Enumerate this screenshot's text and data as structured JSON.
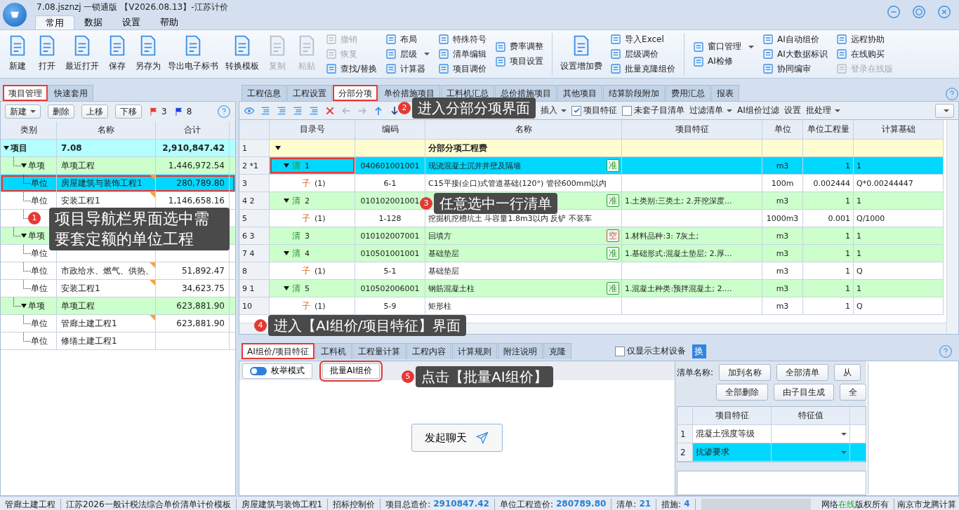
{
  "window": {
    "title": "7.08.jsznzj 一锁通版 【V2026.08.13】-江苏计价"
  },
  "menu_tabs": [
    {
      "label": "常用",
      "selected": true
    },
    {
      "label": "数据",
      "selected": false
    },
    {
      "label": "设置",
      "selected": false
    },
    {
      "label": "帮助",
      "selected": false
    }
  ],
  "ribbon": [
    {
      "kind": "large",
      "label": "新建",
      "disabled": false
    },
    {
      "kind": "large",
      "label": "打开",
      "disabled": false
    },
    {
      "kind": "large",
      "label": "最近打开",
      "disabled": false
    },
    {
      "kind": "large",
      "label": "保存",
      "disabled": false
    },
    {
      "kind": "large",
      "label": "另存为",
      "disabled": false
    },
    {
      "kind": "large",
      "label": "导出电子标书",
      "disabled": false
    },
    {
      "kind": "large",
      "label": "转换模板",
      "disabled": false
    },
    {
      "kind": "large",
      "label": "复制",
      "disabled": true
    },
    {
      "kind": "large",
      "label": "粘贴",
      "disabled": true
    },
    {
      "kind": "column",
      "items": [
        {
          "label": "撤销",
          "disabled": true,
          "dropdown": false
        },
        {
          "label": "恢复",
          "disabled": true,
          "dropdown": false
        },
        {
          "label": "查找/替换",
          "disabled": false,
          "dropdown": false
        }
      ]
    },
    {
      "kind": "column",
      "items": [
        {
          "label": "布局",
          "disabled": false,
          "dropdown": false
        },
        {
          "label": "层级",
          "disabled": false,
          "dropdown": true
        },
        {
          "label": "计算器",
          "disabled": false,
          "dropdown": false
        }
      ]
    },
    {
      "kind": "column",
      "items": [
        {
          "label": "特殊符号",
          "disabled": false,
          "dropdown": false
        },
        {
          "label": "清单编辑",
          "disabled": false,
          "dropdown": false
        },
        {
          "label": "项目调价",
          "disabled": false,
          "dropdown": false
        }
      ]
    },
    {
      "kind": "column",
      "items": [
        {
          "label": "费率调整",
          "disabled": false,
          "dropdown": false
        },
        {
          "label": "项目设置",
          "disabled": false,
          "dropdown": false
        }
      ]
    },
    {
      "kind": "separator"
    },
    {
      "kind": "large",
      "label": "设置增加费",
      "disabled": false
    },
    {
      "kind": "column",
      "items": [
        {
          "label": "导入Excel",
          "disabled": false,
          "dropdown": false
        },
        {
          "label": "层级调价",
          "disabled": false,
          "dropdown": false
        },
        {
          "label": "批量克隆组价",
          "disabled": false,
          "dropdown": false
        }
      ]
    },
    {
      "kind": "separator"
    },
    {
      "kind": "column",
      "items": [
        {
          "label": "窗口管理",
          "disabled": false,
          "dropdown": true
        },
        {
          "label": "AI检修",
          "disabled": false,
          "dropdown": false
        }
      ]
    },
    {
      "kind": "column",
      "items": [
        {
          "label": "AI自动组价",
          "disabled": false,
          "dropdown": false
        },
        {
          "label": "AI大数据标识",
          "disabled": false,
          "dropdown": false
        },
        {
          "label": "协同编审",
          "disabled": false,
          "dropdown": false
        }
      ]
    },
    {
      "kind": "column",
      "items": [
        {
          "label": "远程协助",
          "disabled": false,
          "dropdown": false
        },
        {
          "label": "在线购买",
          "disabled": false,
          "dropdown": false
        },
        {
          "label": "登录在线版",
          "disabled": true,
          "dropdown": false
        }
      ]
    }
  ],
  "left_panel": {
    "tabs": [
      {
        "label": "项目管理",
        "selected": true,
        "highlighted": true
      },
      {
        "label": "快速套用",
        "selected": false,
        "highlighted": false
      }
    ],
    "toolbar": {
      "buttons": [
        {
          "label": "新建",
          "dropdown": true
        },
        {
          "label": "删除",
          "dropdown": false
        },
        {
          "label": "上移",
          "dropdown": false
        },
        {
          "label": "下移",
          "dropdown": false
        }
      ],
      "red_flags": "3",
      "blue_flags": "8"
    },
    "tree": {
      "columns": [
        "类别",
        "名称",
        "合计"
      ],
      "items": [
        {
          "category": "项目",
          "name": "7.08",
          "total": "2,910,847.42",
          "selected": false,
          "highlighted": false,
          "marked": false,
          "expanded": true,
          "children": [
            {
              "category": "单项",
              "name": "单项工程",
              "total": "1,446,972.54",
              "selected": false,
              "highlighted": false,
              "marked": false,
              "expanded": true,
              "children": [
                {
                  "category": "单位",
                  "name": "房屋建筑与装饰工程1",
                  "total": "280,789.80",
                  "selected": true,
                  "highlighted": true,
                  "marked": true
                },
                {
                  "category": "单位",
                  "name": "安装工程1",
                  "total": "1,146,658.16",
                  "selected": false,
                  "highlighted": false,
                  "marked": true
                },
                {
                  "selected": false,
                  "highlighted": false
                }
              ]
            },
            {
              "category": "单项",
              "selected": false,
              "highlighted": false,
              "marked": false,
              "expanded": true,
              "children": [
                {
                  "category": "单位",
                  "selected": false,
                  "highlighted": false
                },
                {
                  "category": "单位",
                  "name": "市政给水、燃气、供热、",
                  "total": "51,892.47",
                  "selected": false,
                  "highlighted": false,
                  "marked": true
                },
                {
                  "category": "单位",
                  "name": "安装工程1",
                  "total": "34,623.75",
                  "selected": false,
                  "highlighted": false,
                  "marked": true
                }
              ]
            },
            {
              "category": "单项",
              "name": "单项工程",
              "total": "623,881.90",
              "selected": false,
              "highlighted": false,
              "marked": false,
              "expanded": true,
              "children": [
                {
                  "category": "单位",
                  "name": "管廊土建工程1",
                  "total": "623,881.90",
                  "selected": false,
                  "highlighted": false,
                  "marked": true
                },
                {
                  "category": "单位",
                  "name": "修缮土建工程1",
                  "selected": false,
                  "highlighted": false,
                  "marked": false
                }
              ]
            }
          ]
        }
      ]
    }
  },
  "right_panel": {
    "tabs": [
      {
        "label": "工程信息",
        "selected": false,
        "highlighted": false
      },
      {
        "label": "工程设置",
        "selected": false,
        "highlighted": false
      },
      {
        "label": "分部分项",
        "selected": true,
        "highlighted": true
      },
      {
        "label": "单价措施项目",
        "selected": false,
        "highlighted": false
      },
      {
        "label": "工料机汇总",
        "selected": false,
        "highlighted": false
      },
      {
        "label": "总价措施项目",
        "selected": false,
        "highlighted": false
      },
      {
        "label": "其他项目",
        "selected": false,
        "highlighted": false
      },
      {
        "label": "结算阶段附加",
        "selected": false,
        "highlighted": false
      },
      {
        "label": "费用汇总",
        "selected": false,
        "highlighted": false
      },
      {
        "label": "报表",
        "selected": false,
        "highlighted": false
      }
    ],
    "toolbar": [
      {
        "kind": "button",
        "label": "插入",
        "dropdown": true
      },
      {
        "kind": "checkbox",
        "label": "项目特征",
        "checked": true
      },
      {
        "kind": "checkbox",
        "label": "未套子目清单",
        "checked": false
      },
      {
        "kind": "button",
        "label": "过滤清单",
        "dropdown": true
      },
      {
        "kind": "button",
        "label": "AI组价过滤",
        "dropdown": false
      },
      {
        "kind": "button",
        "label": "设置",
        "dropdown": false
      },
      {
        "kind": "button",
        "label": "批处理",
        "dropdown": true
      }
    ],
    "grid": {
      "columns": [
        "目录号",
        "编码",
        "名称",
        "项目特征",
        "单位",
        "单位工程量",
        "计算基础"
      ],
      "rows": [
        {
          "kind": "header",
          "number": "1",
          "expanded": true,
          "name": "分部分项工程费",
          "selected": false,
          "highlighted": false
        },
        {
          "kind": "bill",
          "number": "2 *1",
          "expanded": true,
          "type_label": "清",
          "index": "1",
          "code": "040601001001",
          "name": "现浇混凝土沉井井壁及隔墙",
          "badge": {
            "text": "准",
            "color": "#3c9a3c"
          },
          "unit": "m3",
          "quantity": "1",
          "basis": "1",
          "selected": true,
          "highlighted": true
        },
        {
          "kind": "item",
          "number": "3",
          "type_label": "子",
          "index": "(1)",
          "code": "6-1",
          "name": "C15平接(企口)式管道基础(120°) 管径600mm以内",
          "unit": "100m",
          "quantity": "0.002444",
          "basis": "Q*0.00244447",
          "selected": false,
          "highlighted": false
        },
        {
          "kind": "bill",
          "number": "4 2",
          "expanded": true,
          "type_label": "清",
          "index": "2",
          "code": "010102001001",
          "badge": {
            "text": "准",
            "color": "#3c9a3c"
          },
          "feature": "1.土类别:三类土; 2.开挖深度...",
          "unit": "m3",
          "quantity": "1",
          "basis": "1",
          "selected": false,
          "highlighted": false
        },
        {
          "kind": "item",
          "number": "5",
          "type_label": "子",
          "index": "(1)",
          "code": "1-128",
          "name": "挖掘机挖槽坑土 斗容量1.8m3以内 反铲 不装车",
          "unit": "1000m3",
          "quantity": "0.001",
          "basis": "Q/1000",
          "selected": false,
          "highlighted": false
        },
        {
          "kind": "bill",
          "number": "6 3",
          "expanded": false,
          "type_label": "清",
          "index": "3",
          "code": "010102007001",
          "name": "回填方",
          "badge": {
            "text": "空",
            "color": "#c0504d"
          },
          "feature": "1.材料品种:3: 7灰土;",
          "unit": "m3",
          "quantity": "1",
          "basis": "1",
          "selected": false,
          "highlighted": false
        },
        {
          "kind": "bill",
          "number": "7 4",
          "expanded": true,
          "type_label": "清",
          "index": "4",
          "code": "010501001001",
          "name": "基础垫层",
          "badge": {
            "text": "准",
            "color": "#3c9a3c"
          },
          "feature": "1.基础形式:混凝土垫层; 2.厚...",
          "unit": "m3",
          "quantity": "1",
          "basis": "1",
          "selected": false,
          "highlighted": false
        },
        {
          "kind": "item",
          "number": "8",
          "type_label": "子",
          "index": "(1)",
          "code": "5-1",
          "name": "基础垫层",
          "unit": "m3",
          "quantity": "1",
          "basis": "Q",
          "selected": false,
          "highlighted": false
        },
        {
          "kind": "bill",
          "number": "9 1",
          "expanded": true,
          "type_label": "清",
          "index": "5",
          "code": "010502006001",
          "name": "钢筋混凝土柱",
          "badge": {
            "text": "准",
            "color": "#3c9a3c"
          },
          "feature": "1.混凝土种类:预拌混凝土; 2....",
          "unit": "m3",
          "quantity": "1",
          "basis": "1",
          "selected": false,
          "highlighted": false
        },
        {
          "kind": "item",
          "number": "10",
          "type_label": "子",
          "index": "(1)",
          "code": "5-9",
          "name": "矩形柱",
          "unit": "m3",
          "quantity": "1",
          "basis": "Q",
          "selected": false,
          "highlighted": false
        }
      ]
    }
  },
  "bottom_panel": {
    "tabs": [
      {
        "label": "AI组价/项目特征",
        "selected": true,
        "highlighted": true
      },
      {
        "label": "工料机",
        "selected": false,
        "highlighted": false
      },
      {
        "label": "工程量计算",
        "selected": false,
        "highlighted": false
      },
      {
        "label": "工程内容",
        "selected": false,
        "highlighted": false
      },
      {
        "label": "计算规则",
        "selected": false,
        "highlighted": false
      },
      {
        "label": "附注说明",
        "selected": false,
        "highlighted": false
      },
      {
        "label": "克隆",
        "selected": false,
        "highlighted": false
      }
    ],
    "main_only": {
      "label": "仅显示主材设备",
      "checked": false
    },
    "swap_button": "换",
    "mode_toggle": {
      "label": "枚举模式",
      "on": true
    },
    "batch_button": {
      "label": "批量AI组价",
      "highlighted": true
    },
    "chat_button": "发起聊天",
    "feature_panel": {
      "label": "清单名称:",
      "button_rows": [
        [
          "加到名称",
          "全部清单",
          "从"
        ],
        [
          "全部删除",
          "由子目生成",
          "全"
        ]
      ],
      "columns": [
        "项目特征",
        "特征值"
      ],
      "rows": [
        {
          "number": "1",
          "feature": "混凝土强度等级",
          "selected": false
        },
        {
          "number": "2",
          "feature": "抗渗要求",
          "selected": true
        }
      ]
    }
  },
  "status_bar": {
    "segments": [
      {
        "label": "管廊土建工程"
      },
      {
        "label": "江苏2026一般计税法综合单价清单计价模板"
      },
      {
        "label": "房屋建筑与装饰工程1"
      },
      {
        "label": "招标控制价"
      },
      {
        "label": "项目总造价:",
        "value": "2910847.42"
      },
      {
        "label": "单位工程造价:",
        "value": "280789.80"
      },
      {
        "label": "清单:",
        "value": "21"
      },
      {
        "label": "措施:",
        "value": "4"
      }
    ],
    "network": {
      "prefix": "网络",
      "status": "在线",
      "suffix": "版权所有"
    },
    "company": "南京市龙腾计算"
  },
  "callouts": [
    {
      "number": "1",
      "text": "项目导航栏界面选中需要套定额的单位工程"
    },
    {
      "number": "2",
      "text": "进入分部分项界面"
    },
    {
      "number": "3",
      "text": "任意选中一行清单"
    },
    {
      "number": "4",
      "text": "进入【AI组价/项目特征】界面"
    },
    {
      "number": "5",
      "text": "点击【批量AI组价】"
    }
  ]
}
